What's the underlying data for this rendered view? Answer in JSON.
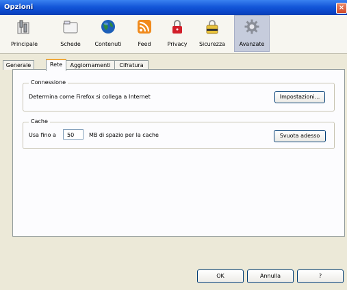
{
  "window": {
    "title": "Opzioni",
    "close_glyph": "×"
  },
  "toolbar": {
    "items": [
      {
        "label": "Principale",
        "icon": "main-settings-icon",
        "selected": false
      },
      {
        "label": "Schede",
        "icon": "tabs-icon",
        "selected": false
      },
      {
        "label": "Contenuti",
        "icon": "globe-icon",
        "selected": false
      },
      {
        "label": "Feed",
        "icon": "rss-feed-icon",
        "selected": false
      },
      {
        "label": "Privacy",
        "icon": "lock-icon",
        "selected": false
      },
      {
        "label": "Sicurezza",
        "icon": "security-shield-icon",
        "selected": false
      },
      {
        "label": "Avanzate",
        "icon": "gear-icon",
        "selected": true
      }
    ]
  },
  "tabs": [
    {
      "label": "Generale",
      "active": false
    },
    {
      "label": "Rete",
      "active": true
    },
    {
      "label": "Aggiornamenti",
      "active": false
    },
    {
      "label": "Cifratura",
      "active": false
    }
  ],
  "connessione": {
    "title": "Connessione",
    "description": "Determina come Firefox si collega a Internet",
    "button": "Impostazioni..."
  },
  "cache": {
    "title": "Cache",
    "prefix": "Usa fino a",
    "value": "50",
    "suffix": "MB di spazio per la cache",
    "button": "Svuota adesso"
  },
  "dialog_buttons": {
    "ok": "OK",
    "cancel": "Annulla",
    "help": "?"
  },
  "colors": {
    "titlebar": "#0a46c8",
    "selected_toolbar": "#c6ccdc",
    "active_tab_accent": "#f0a83a"
  }
}
